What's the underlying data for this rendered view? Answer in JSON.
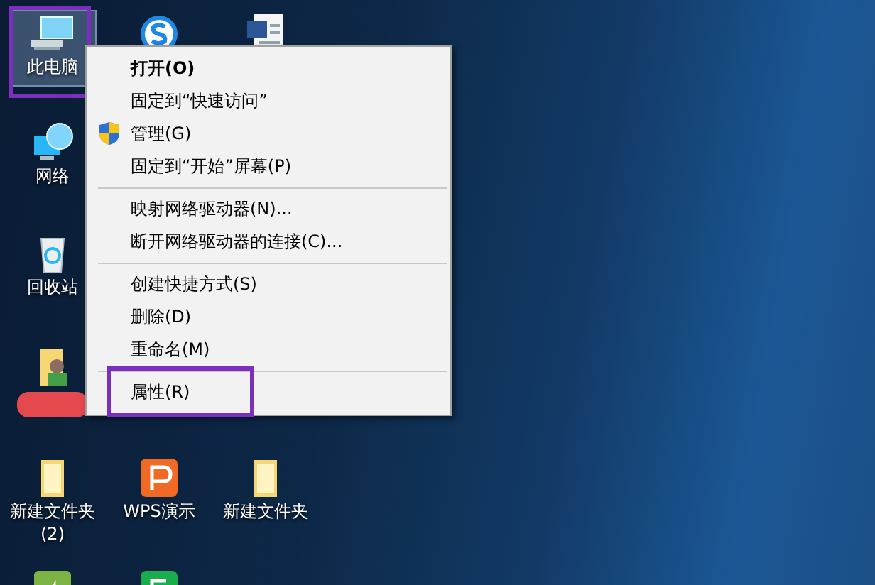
{
  "desktop_icons": [
    {
      "kind": "computer",
      "label": "此电脑",
      "selected": true,
      "annotated": true
    },
    {
      "kind": "s-app"
    },
    {
      "kind": "word-doc"
    },
    {
      "kind": "network",
      "label": "网络",
      "selected": false
    },
    {
      "kind": "recycle-bin",
      "label": "回收站",
      "selected": false
    },
    {
      "kind": "user-folder",
      "redacted": true,
      "selected": false
    },
    {
      "kind": "folder",
      "label": "新建文件夹 (2)",
      "selected": false
    },
    {
      "kind": "wps-slides",
      "label": "WPS演示",
      "selected": false
    },
    {
      "kind": "folder",
      "label": "新建文件夹",
      "selected": false
    },
    {
      "kind": "chart-app"
    },
    {
      "kind": "green-s-app"
    }
  ],
  "context_menu": [
    {
      "kind": "item",
      "label": "打开(O)",
      "default": true
    },
    {
      "kind": "item",
      "label": "固定到“快速访问”"
    },
    {
      "kind": "item",
      "label": "管理(G)",
      "shield": true
    },
    {
      "kind": "item",
      "label": "固定到“开始”屏幕(P)"
    },
    {
      "kind": "separator"
    },
    {
      "kind": "item",
      "label": "映射网络驱动器(N)..."
    },
    {
      "kind": "item",
      "label": "断开网络驱动器的连接(C)..."
    },
    {
      "kind": "separator"
    },
    {
      "kind": "item",
      "label": "创建快捷方式(S)"
    },
    {
      "kind": "item",
      "label": "删除(D)"
    },
    {
      "kind": "item",
      "label": "重命名(M)"
    },
    {
      "kind": "separator"
    },
    {
      "kind": "item",
      "label": "属性(R)",
      "annotated": true
    }
  ]
}
